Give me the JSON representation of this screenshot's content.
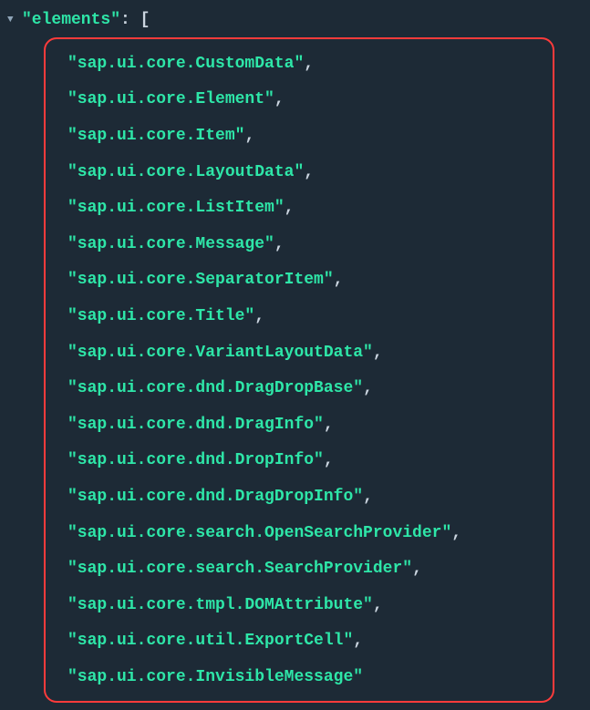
{
  "root": {
    "keyName": "\"elements\"",
    "colon": ":",
    "bracket": "["
  },
  "items": [
    "\"sap.ui.core.CustomData\"",
    "\"sap.ui.core.Element\"",
    "\"sap.ui.core.Item\"",
    "\"sap.ui.core.LayoutData\"",
    "\"sap.ui.core.ListItem\"",
    "\"sap.ui.core.Message\"",
    "\"sap.ui.core.SeparatorItem\"",
    "\"sap.ui.core.Title\"",
    "\"sap.ui.core.VariantLayoutData\"",
    "\"sap.ui.core.dnd.DragDropBase\"",
    "\"sap.ui.core.dnd.DragInfo\"",
    "\"sap.ui.core.dnd.DropInfo\"",
    "\"sap.ui.core.dnd.DragDropInfo\"",
    "\"sap.ui.core.search.OpenSearchProvider\"",
    "\"sap.ui.core.search.SearchProvider\"",
    "\"sap.ui.core.tmpl.DOMAttribute\"",
    "\"sap.ui.core.util.ExportCell\"",
    "\"sap.ui.core.InvisibleMessage\""
  ],
  "comma": ","
}
